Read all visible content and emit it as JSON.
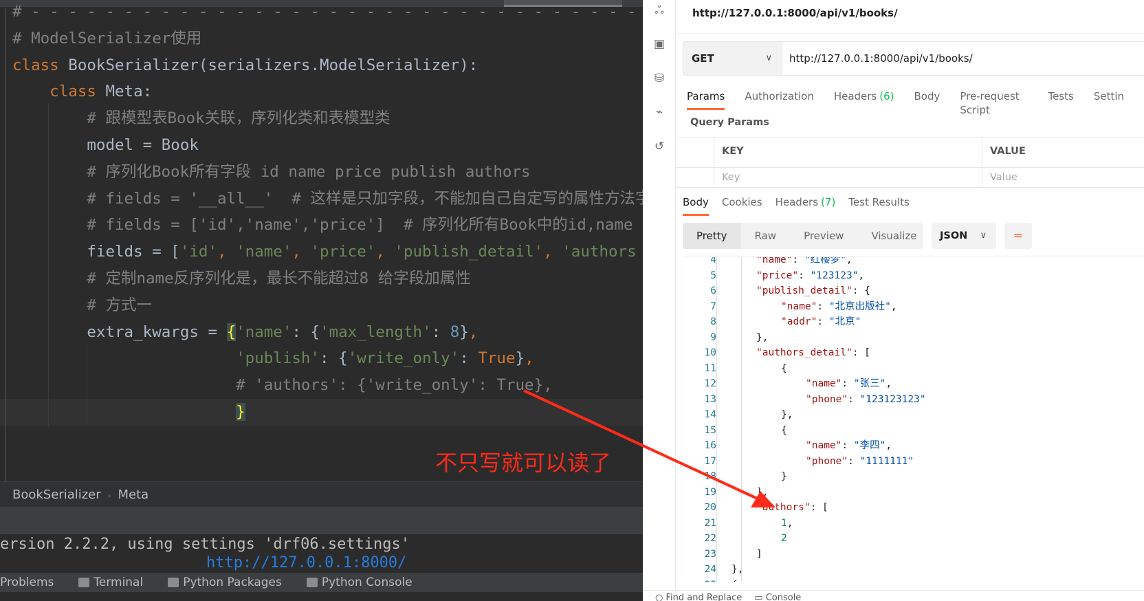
{
  "editor": {
    "lines": [
      [
        {
          "t": "# ",
          "c": "cm"
        },
        {
          "t": "- - - - - - - - - - - - - - - - - - - - - - - - - - - - - - - - - - -",
          "c": "cm"
        }
      ],
      [
        {
          "t": "# ModelSerializer使用",
          "c": "cm"
        }
      ],
      [
        {
          "t": "class ",
          "c": "kw"
        },
        {
          "t": "BookSerializer(serializers.ModelSerializer):",
          "c": ""
        }
      ],
      [
        {
          "t": "    class ",
          "c": "kw"
        },
        {
          "t": "Meta:",
          "c": ""
        }
      ],
      [
        {
          "t": "        # 跟模型表Book关联，序列化类和表模型类",
          "c": "cm"
        }
      ],
      [
        {
          "t": "        model = Book",
          "c": ""
        }
      ],
      [
        {
          "t": "        # 序列化Book所有字段 id name price publish authors",
          "c": "cm"
        }
      ],
      [
        {
          "t": "        # fields = '__all__'  # 这样是只加字段，不能加自己自定写的属性方法字",
          "c": "cm"
        }
      ],
      [
        {
          "t": "        # fields = ['id','name','price']  # 序列化所有Book中的id,name",
          "c": "cm"
        }
      ],
      [
        {
          "t": "        fields = [",
          "c": ""
        },
        {
          "t": "'id'",
          "c": "st"
        },
        {
          "t": ", ",
          "c": "kw"
        },
        {
          "t": "'name'",
          "c": "st"
        },
        {
          "t": ", ",
          "c": "kw"
        },
        {
          "t": "'price'",
          "c": "st"
        },
        {
          "t": ", ",
          "c": "kw"
        },
        {
          "t": "'publish_detail'",
          "c": "st"
        },
        {
          "t": ", ",
          "c": "kw"
        },
        {
          "t": "'authors",
          "c": "st"
        }
      ],
      [
        {
          "t": "        # 定制name反序列化是，最长不能超过8 给字段加属性",
          "c": "cm"
        }
      ],
      [
        {
          "t": "        # 方式一",
          "c": "cm"
        }
      ],
      [
        {
          "t": "        extra_kwargs = ",
          "c": ""
        },
        {
          "t": "{",
          "c": "br"
        },
        {
          "t": "'name'",
          "c": "st"
        },
        {
          "t": ": {",
          "c": ""
        },
        {
          "t": "'max_length'",
          "c": "st"
        },
        {
          "t": ": ",
          "c": ""
        },
        {
          "t": "8",
          "c": "nu"
        },
        {
          "t": "}",
          "c": ""
        },
        {
          "t": ",",
          "c": "kw"
        }
      ],
      [
        {
          "t": "                        ",
          "c": ""
        },
        {
          "t": "'publish'",
          "c": "st"
        },
        {
          "t": ": {",
          "c": ""
        },
        {
          "t": "'write_only'",
          "c": "st"
        },
        {
          "t": ": ",
          "c": ""
        },
        {
          "t": "True",
          "c": "kw"
        },
        {
          "t": "}",
          "c": ""
        },
        {
          "t": ",",
          "c": "kw"
        }
      ],
      [
        {
          "t": "                        # 'authors': {'write_only': True},",
          "c": "cm"
        }
      ],
      [
        {
          "t": "                        ",
          "c": ""
        },
        {
          "t": "}",
          "c": "br"
        }
      ]
    ],
    "breadcrumb": [
      "BookSerializer",
      "Meta"
    ],
    "terminal_line": "ersion 2.2.2, using settings 'drf06.settings'",
    "terminal_link": "http://127.0.0.1:8000/",
    "toolbar": [
      "Problems",
      "Terminal",
      "Python Packages",
      "Python Console"
    ],
    "annotation": "不只写就可以读了",
    "annotation_color": "#ff2a1a"
  },
  "postman": {
    "sidebar_icons": [
      "apis-icon",
      "environments-icon",
      "mock-servers-icon",
      "monitors-icon",
      "history-icon"
    ],
    "request_title": "http://127.0.0.1:8000/api/v1/books/",
    "method": "GET",
    "url": "http://127.0.0.1:8000/api/v1/books/",
    "request_tabs": [
      {
        "label": "Params",
        "count": ""
      },
      {
        "label": "Authorization",
        "count": ""
      },
      {
        "label": "Headers",
        "count": "(6)"
      },
      {
        "label": "Body",
        "count": ""
      },
      {
        "label": "Pre-request Script",
        "count": ""
      },
      {
        "label": "Tests",
        "count": ""
      },
      {
        "label": "Settin",
        "count": ""
      }
    ],
    "query_params_title": "Query Params",
    "table": {
      "key_header": "KEY",
      "value_header": "VALUE",
      "key_placeholder": "Key",
      "value_placeholder": "Value"
    },
    "response_tabs": [
      {
        "label": "Body",
        "count": ""
      },
      {
        "label": "Cookies",
        "count": ""
      },
      {
        "label": "Headers",
        "count": "(7)"
      },
      {
        "label": "Test Results",
        "count": ""
      }
    ],
    "view_modes": [
      "Pretty",
      "Raw",
      "Preview",
      "Visualize"
    ],
    "format": "JSON",
    "accent": "#ff6c37",
    "json_lines": [
      {
        "n": "4",
        "i": 2,
        "tk": [
          {
            "t": "\"name\"",
            "c": "k"
          },
          {
            "t": ": ",
            "c": "p"
          },
          {
            "t": "\"红楼梦\"",
            "c": "s"
          },
          {
            "t": ",",
            "c": "p"
          }
        ]
      },
      {
        "n": "5",
        "i": 2,
        "tk": [
          {
            "t": "\"price\"",
            "c": "k"
          },
          {
            "t": ": ",
            "c": "p"
          },
          {
            "t": "\"123123\"",
            "c": "s"
          },
          {
            "t": ",",
            "c": "p"
          }
        ]
      },
      {
        "n": "6",
        "i": 2,
        "tk": [
          {
            "t": "\"publish_detail\"",
            "c": "k"
          },
          {
            "t": ": {",
            "c": "p"
          }
        ]
      },
      {
        "n": "7",
        "i": 3,
        "tk": [
          {
            "t": "\"name\"",
            "c": "k"
          },
          {
            "t": ": ",
            "c": "p"
          },
          {
            "t": "\"北京出版社\"",
            "c": "s"
          },
          {
            "t": ",",
            "c": "p"
          }
        ]
      },
      {
        "n": "8",
        "i": 3,
        "tk": [
          {
            "t": "\"addr\"",
            "c": "k"
          },
          {
            "t": ": ",
            "c": "p"
          },
          {
            "t": "\"北京\"",
            "c": "s"
          }
        ]
      },
      {
        "n": "9",
        "i": 2,
        "tk": [
          {
            "t": "},",
            "c": "p"
          }
        ]
      },
      {
        "n": "10",
        "i": 2,
        "tk": [
          {
            "t": "\"authors_detail\"",
            "c": "k"
          },
          {
            "t": ": [",
            "c": "p"
          }
        ]
      },
      {
        "n": "11",
        "i": 3,
        "tk": [
          {
            "t": "{",
            "c": "p"
          }
        ]
      },
      {
        "n": "12",
        "i": 4,
        "tk": [
          {
            "t": "\"name\"",
            "c": "k"
          },
          {
            "t": ": ",
            "c": "p"
          },
          {
            "t": "\"张三\"",
            "c": "s"
          },
          {
            "t": ",",
            "c": "p"
          }
        ]
      },
      {
        "n": "13",
        "i": 4,
        "tk": [
          {
            "t": "\"phone\"",
            "c": "k"
          },
          {
            "t": ": ",
            "c": "p"
          },
          {
            "t": "\"123123123\"",
            "c": "s"
          }
        ]
      },
      {
        "n": "14",
        "i": 3,
        "tk": [
          {
            "t": "},",
            "c": "p"
          }
        ]
      },
      {
        "n": "15",
        "i": 3,
        "tk": [
          {
            "t": "{",
            "c": "p"
          }
        ]
      },
      {
        "n": "16",
        "i": 4,
        "tk": [
          {
            "t": "\"name\"",
            "c": "k"
          },
          {
            "t": ": ",
            "c": "p"
          },
          {
            "t": "\"李四\"",
            "c": "s"
          },
          {
            "t": ",",
            "c": "p"
          }
        ]
      },
      {
        "n": "17",
        "i": 4,
        "tk": [
          {
            "t": "\"phone\"",
            "c": "k"
          },
          {
            "t": ": ",
            "c": "p"
          },
          {
            "t": "\"1111111\"",
            "c": "s"
          }
        ]
      },
      {
        "n": "18",
        "i": 3,
        "tk": [
          {
            "t": "}",
            "c": "p"
          }
        ]
      },
      {
        "n": "19",
        "i": 2,
        "tk": [
          {
            "t": "],",
            "c": "p"
          }
        ]
      },
      {
        "n": "20",
        "i": 2,
        "tk": [
          {
            "t": "\"authors\"",
            "c": "k"
          },
          {
            "t": ": [",
            "c": "p"
          }
        ]
      },
      {
        "n": "21",
        "i": 3,
        "tk": [
          {
            "t": "1",
            "c": "n"
          },
          {
            "t": ",",
            "c": "p"
          }
        ]
      },
      {
        "n": "22",
        "i": 3,
        "tk": [
          {
            "t": "2",
            "c": "n"
          }
        ]
      },
      {
        "n": "23",
        "i": 2,
        "tk": [
          {
            "t": "]",
            "c": "p"
          }
        ]
      },
      {
        "n": "24",
        "i": 1,
        "tk": [
          {
            "t": "},",
            "c": "p"
          }
        ]
      },
      {
        "n": "25",
        "i": 1,
        "tk": [
          {
            "t": "{",
            "c": "p"
          }
        ]
      }
    ],
    "statusbar": [
      "Find and Replace",
      "Console"
    ]
  }
}
